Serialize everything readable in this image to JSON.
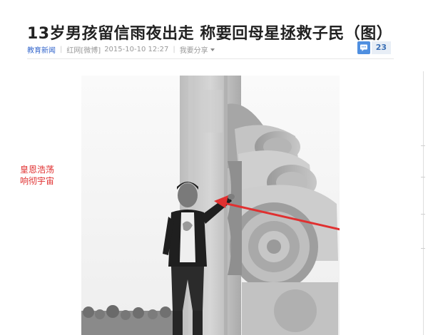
{
  "article": {
    "title": "13岁男孩留信雨夜出走 称要回母星拯救子民（图）",
    "channel": "教育新闻",
    "source": "红网[微博]",
    "date": "2015-10-10 12:27",
    "share_label": "我要分享",
    "comment_count": "23"
  },
  "photo": {
    "annotation_line1": "皇恩浩荡",
    "annotation_line2": "响彻宇宙",
    "arrow_color": "#e03030",
    "description": "grayscale photo of a boy standing beside a carved stone pillar"
  },
  "icons": {
    "comment": "comment-icon",
    "dropdown": "chevron-down-icon"
  },
  "colors": {
    "link": "#3366cc",
    "annotation": "#e03030",
    "comment_badge": "#4f8fe0"
  }
}
